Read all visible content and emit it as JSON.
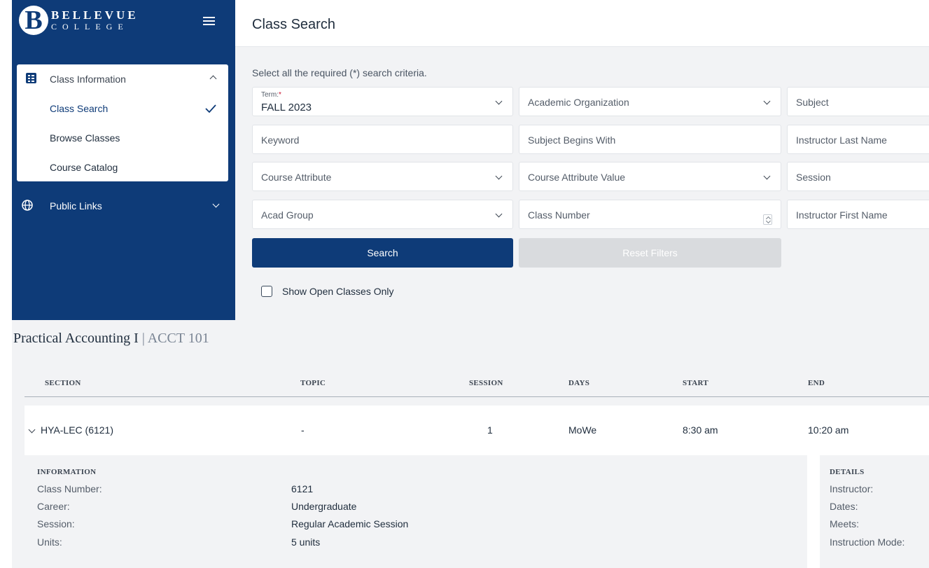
{
  "brand": {
    "mark": "B",
    "line1": "BELLEVUE",
    "line2": "COLLEGE",
    "color": "#0e3b78"
  },
  "sidebar": {
    "section": {
      "label": "Class Information",
      "icon": "list-card-icon"
    },
    "items": [
      {
        "label": "Class Search",
        "active": true
      },
      {
        "label": "Browse Classes"
      },
      {
        "label": "Course Catalog"
      }
    ],
    "public_links": {
      "label": "Public Links",
      "icon": "globe-icon"
    }
  },
  "header": {
    "title": "Class Search"
  },
  "search": {
    "instructions": "Select all the required (*) search criteria.",
    "term": {
      "label": "Term:",
      "required": "*",
      "value": "FALL 2023"
    },
    "fields": {
      "academic_organization": "Academic Organization",
      "subject": "Subject",
      "keyword": "Keyword",
      "subject_begins_with": "Subject Begins With",
      "instructor_last_name": "Instructor Last Name",
      "course_attribute": "Course Attribute",
      "course_attribute_value": "Course Attribute Value",
      "session": "Session",
      "acad_group": "Acad Group",
      "class_number": "Class Number",
      "instructor_first_name": "Instructor First Name"
    },
    "search_button": "Search",
    "reset_button": "Reset Filters",
    "open_only_label": "Show Open Classes Only",
    "open_only_checked": false
  },
  "course": {
    "title": "Practical Accounting I",
    "separator": " | ",
    "code": "ACCT 101",
    "columns": [
      "SECTION",
      "TOPIC",
      "SESSION",
      "DAYS",
      "START",
      "END"
    ],
    "sections": [
      {
        "section": "HYA-LEC (6121)",
        "topic": "-",
        "session": "1",
        "days": "MoWe",
        "start": "8:30 am",
        "end": "10:20 am",
        "information_heading": "INFORMATION",
        "information": [
          {
            "key": "Class Number:",
            "value": "6121"
          },
          {
            "key": "Career:",
            "value": "Undergraduate"
          },
          {
            "key": "Session:",
            "value": "Regular Academic Session"
          },
          {
            "key": "Units:",
            "value": "5 units"
          }
        ],
        "details_heading": "DETAILS",
        "details": [
          {
            "key": "Instructor:"
          },
          {
            "key": "Dates:"
          },
          {
            "key": "Meets:"
          },
          {
            "key": "Instruction Mode:"
          }
        ]
      }
    ]
  }
}
